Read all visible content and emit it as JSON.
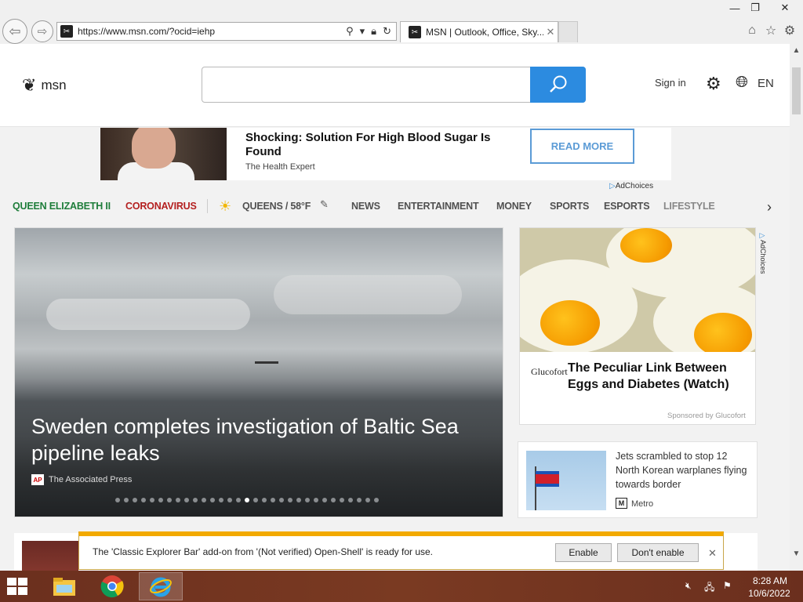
{
  "browser": {
    "url": "https://www.msn.com/?ocid=iehp",
    "tab_title": "MSN | Outlook, Office, Sky...",
    "tab_close": "✕",
    "back_icon": "back-arrow-icon",
    "forward_icon": "forward-arrow-icon"
  },
  "header": {
    "logo_text": "msn",
    "search_placeholder": "",
    "sign_in": "Sign in",
    "language": "EN"
  },
  "ad_banner": {
    "title": "Shocking: Solution For High Blood Sugar Is Found",
    "source": "The Health Expert",
    "button": "READ MORE",
    "adchoices": "AdChoices"
  },
  "nav": {
    "items": [
      "QUEEN ELIZABETH II",
      "CORONAVIRUS",
      "QUEENS / 58°F",
      "NEWS",
      "ENTERTAINMENT",
      "MONEY",
      "SPORTS",
      "ESPORTS",
      "LIFESTYLE"
    ]
  },
  "hero": {
    "title": "Sweden completes investigation of Baltic Sea pipeline leaks",
    "source_logo": "AP",
    "source": "The Associated Press",
    "dot_count": 31,
    "active_dot": 15
  },
  "ad_card": {
    "brand": "Glucofort",
    "title": "The Peculiar Link Between Eggs and Diabetes (Watch)",
    "sponsor": "Sponsored by Glucofort",
    "adchoices": "AdChoices"
  },
  "news_card": {
    "title": "Jets scrambled to stop 12 North Korean warplanes flying towards border",
    "source_logo": "M",
    "source": "Metro"
  },
  "notification": {
    "message": "The 'Classic Explorer Bar' add-on from '(Not verified) Open-Shell' is ready for use.",
    "enable": "Enable",
    "dont_enable": "Don't enable",
    "close": "✕"
  },
  "taskbar": {
    "time": "8:28 AM",
    "date": "10/6/2022"
  },
  "colors": {
    "search_blue": "#2c8be0",
    "nav_green": "#1e7d3a",
    "nav_red": "#b42020",
    "notification_accent": "#f2a900",
    "taskbar": "#6b2f1e"
  }
}
